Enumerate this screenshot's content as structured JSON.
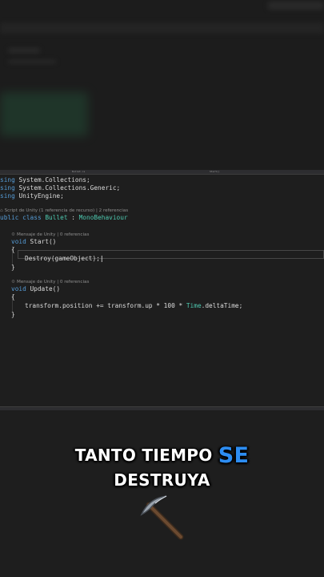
{
  "editor": {
    "tab_left": "Bullet.cs",
    "tab_right": "Start()",
    "lines": {
      "using1_kw": "sing",
      "using1_rest": " System.Collections;",
      "using2_kw": "sing",
      "using2_rest": " System.Collections.Generic;",
      "using3_kw": "sing",
      "using3_rest": " UnityEngine;",
      "class_meta": "Script de Unity (1 referencia de recurso) | 2 referencias",
      "class_kw": "ublic class",
      "class_name": "Bullet",
      "class_colon": " : ",
      "class_base": "MonoBehaviour",
      "start_meta": "Mensaje de Unity | 0 referencias",
      "start_kw": "void",
      "start_name": " Start()",
      "open1": "{",
      "destroy": "Destroy(gameObject);",
      "close1": "}",
      "update_meta": "Mensaje de Unity | 0 referencias",
      "update_kw": "void",
      "update_name": " Update()",
      "open2": "{",
      "update_body_a": "transform.position += transform.up * 100 * ",
      "update_body_time": "Time",
      "update_body_b": ".deltaTime;",
      "close2": "}"
    }
  },
  "caption": {
    "line1_a": "TANTO TIEMPO ",
    "line1_highlight": "SE",
    "line2": "DESTRUYA",
    "highlight_color": "#2d8df2"
  },
  "icons": {
    "pickaxe": "pickaxe-icon"
  }
}
